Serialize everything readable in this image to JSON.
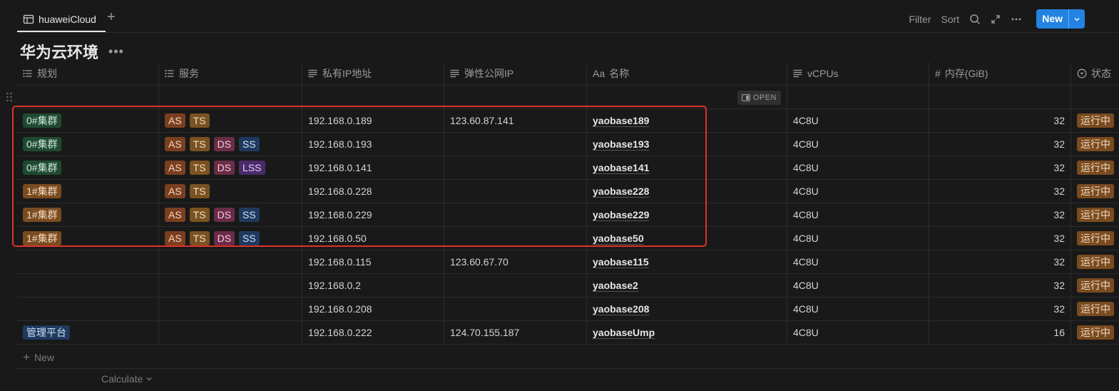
{
  "tab": {
    "label": "huaweiCloud"
  },
  "toolbar": {
    "filter": "Filter",
    "sort": "Sort",
    "new_label": "New"
  },
  "page": {
    "title": "华为云环境"
  },
  "columns": [
    {
      "label": "规划",
      "icon": "list-icon"
    },
    {
      "label": "服务",
      "icon": "list-icon"
    },
    {
      "label": "私有IP地址",
      "icon": "text-icon"
    },
    {
      "label": "弹性公网IP",
      "icon": "text-icon"
    },
    {
      "label": "名称",
      "icon": "title-icon",
      "prefix": "Aa"
    },
    {
      "label": "vCPUs",
      "icon": "text-icon"
    },
    {
      "label": "内存(GiB)",
      "icon": "number-icon",
      "prefix": "#"
    },
    {
      "label": "状态",
      "icon": "status-icon"
    }
  ],
  "open_label": "OPEN",
  "rows": [
    {
      "cluster": "0#集群",
      "cluster_color": "green",
      "services": [
        "AS",
        "TS"
      ],
      "private_ip": "192.168.0.189",
      "public_ip": "123.60.87.141",
      "name": "yaobase189",
      "vcpus": "4C8U",
      "memory": "32",
      "status": "运行中"
    },
    {
      "cluster": "0#集群",
      "cluster_color": "green",
      "services": [
        "AS",
        "TS",
        "DS",
        "SS"
      ],
      "private_ip": "192.168.0.193",
      "public_ip": "",
      "name": "yaobase193",
      "vcpus": "4C8U",
      "memory": "32",
      "status": "运行中"
    },
    {
      "cluster": "0#集群",
      "cluster_color": "green",
      "services": [
        "AS",
        "TS",
        "DS",
        "LSS"
      ],
      "private_ip": "192.168.0.141",
      "public_ip": "",
      "name": "yaobase141",
      "vcpus": "4C8U",
      "memory": "32",
      "status": "运行中"
    },
    {
      "cluster": "1#集群",
      "cluster_color": "orange",
      "services": [
        "AS",
        "TS"
      ],
      "private_ip": "192.168.0.228",
      "public_ip": "",
      "name": "yaobase228",
      "vcpus": "4C8U",
      "memory": "32",
      "status": "运行中"
    },
    {
      "cluster": "1#集群",
      "cluster_color": "orange",
      "services": [
        "AS",
        "TS",
        "DS",
        "SS"
      ],
      "private_ip": "192.168.0.229",
      "public_ip": "",
      "name": "yaobase229",
      "vcpus": "4C8U",
      "memory": "32",
      "status": "运行中"
    },
    {
      "cluster": "1#集群",
      "cluster_color": "orange",
      "services": [
        "AS",
        "TS",
        "DS",
        "SS"
      ],
      "private_ip": "192.168.0.50",
      "public_ip": "",
      "name": "yaobase50",
      "vcpus": "4C8U",
      "memory": "32",
      "status": "运行中"
    },
    {
      "cluster": "",
      "cluster_color": "",
      "services": [],
      "private_ip": "192.168.0.115",
      "public_ip": "123.60.67.70",
      "name": "yaobase115",
      "vcpus": "4C8U",
      "memory": "32",
      "status": "运行中"
    },
    {
      "cluster": "",
      "cluster_color": "",
      "services": [],
      "private_ip": "192.168.0.2",
      "public_ip": "",
      "name": "yaobase2",
      "vcpus": "4C8U",
      "memory": "32",
      "status": "运行中"
    },
    {
      "cluster": "",
      "cluster_color": "",
      "services": [],
      "private_ip": "192.168.0.208",
      "public_ip": "",
      "name": "yaobase208",
      "vcpus": "4C8U",
      "memory": "32",
      "status": "运行中"
    },
    {
      "cluster": "管理平台",
      "cluster_color": "blue",
      "services": [],
      "private_ip": "192.168.0.222",
      "public_ip": "124.70.155.187",
      "name": "yaobaseUmp",
      "vcpus": "4C8U",
      "memory": "16",
      "status": "运行中"
    }
  ],
  "tag_colors": {
    "green": {
      "bg": "#1f4a32",
      "fg": "#cfe8d8"
    },
    "orange": {
      "bg": "#7a4b1f",
      "fg": "#f3dcc4"
    },
    "blue": {
      "bg": "#1e3a5f",
      "fg": "#cfe0f5"
    },
    "AS": {
      "bg": "#7a3f1f",
      "fg": "#f3d6c4"
    },
    "TS": {
      "bg": "#7a5222",
      "fg": "#f3dfc4"
    },
    "DS": {
      "bg": "#6a2c47",
      "fg": "#f1cfdd"
    },
    "SS": {
      "bg": "#1e3a5f",
      "fg": "#cfe0f5"
    },
    "LSS": {
      "bg": "#4a2b6a",
      "fg": "#e2d0f3"
    },
    "status": {
      "bg": "#7a4b1f",
      "fg": "#f3dcc4"
    }
  },
  "footer": {
    "new_label": "New",
    "calculate_label": "Calculate"
  }
}
